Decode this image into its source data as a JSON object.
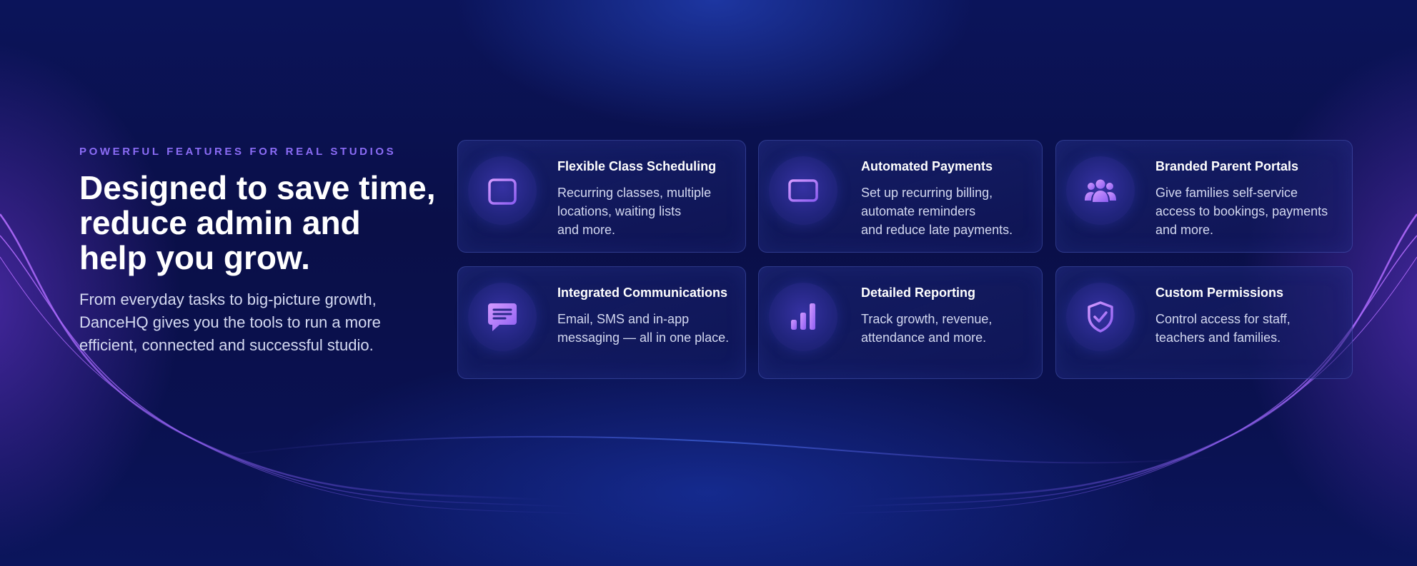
{
  "intro": {
    "eyebrow": "POWERFUL FEATURES FOR REAL STUDIOS",
    "headline_lines": [
      "Designed to save time,",
      "reduce admin and",
      "help you grow."
    ],
    "subtext_lines": [
      "From everyday tasks to big-picture growth,",
      "DanceHQ gives you the tools to run a more",
      "efficient, connected and successful studio."
    ]
  },
  "features": [
    {
      "title": "Flexible Class Scheduling",
      "icon": "calendar-icon",
      "desc_lines": [
        "Recurring classes, multiple",
        "locations, waiting lists",
        "and more."
      ]
    },
    {
      "title": "Automated Payments",
      "icon": "credit-card-icon",
      "desc_lines": [
        "Set up recurring billing,",
        "automate reminders",
        "and reduce late payments."
      ]
    },
    {
      "title": "Branded Parent Portals",
      "icon": "users-icon",
      "desc_lines": [
        "Give families self-service",
        "access to bookings, payments",
        "and more."
      ]
    },
    {
      "title": "Integrated Communications",
      "icon": "chat-icon",
      "desc_lines": [
        "Email, SMS and in-app",
        "messaging — all in one place."
      ]
    },
    {
      "title": "Detailed Reporting",
      "icon": "bar-chart-icon",
      "desc_lines": [
        "Track growth, revenue,",
        "attendance and more."
      ]
    },
    {
      "title": "Custom Permissions",
      "icon": "shield-check-icon",
      "desc_lines": [
        "Control access for staff,",
        "teachers and families."
      ]
    }
  ],
  "colors": {
    "accent_purple": "#8b6cf6",
    "icon_gradient_start": "#c48cf8",
    "icon_gradient_end": "#8a5cf0",
    "background": "#0a1045"
  }
}
